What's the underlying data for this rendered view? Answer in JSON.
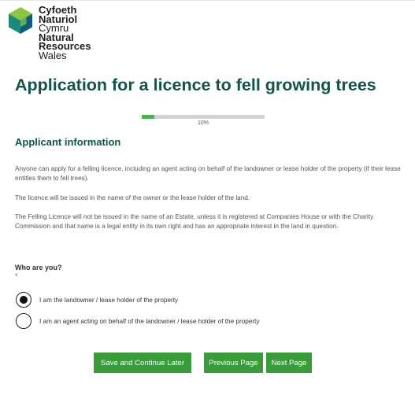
{
  "logo": {
    "line1": "Cyfoeth",
    "line2": "Naturiol",
    "line3": "Cymru",
    "line4": "Natural",
    "line5": "Resources",
    "line6": "Wales"
  },
  "page": {
    "title": "Application for a licence to fell growing trees"
  },
  "progress": {
    "percent": 10,
    "label": "10%"
  },
  "section": {
    "heading": "Applicant information",
    "paragraphs": [
      "Anyone can apply for a felling licence, including an agent acting on behalf of the landowner or lease holder of the property (if their lease entitles them to fell trees).",
      "The licence will be issued in the name of the owner or the lease holder of the land.",
      "The Felling Licence will not be issued in the name of an Estate, unless it is registered at Companies House or with the Charity Commission and that name is a legal entity in its own right and has an appropriate interest in the land in question."
    ]
  },
  "question": {
    "label": "Who are you?",
    "required_marker": "*",
    "options": [
      {
        "label": "I am the landowner / lease holder of the property",
        "selected": true
      },
      {
        "label": "I am an agent acting on behalf of the landowner / lease holder of the property",
        "selected": false
      }
    ]
  },
  "buttons": {
    "save": "Save and Continue Later",
    "previous": "Previous Page",
    "next": "Next Page"
  },
  "colors": {
    "heading": "#14524a",
    "button": "#3a9b3a",
    "progress_fill": "#4caf50",
    "progress_track": "#d1d1d1"
  }
}
